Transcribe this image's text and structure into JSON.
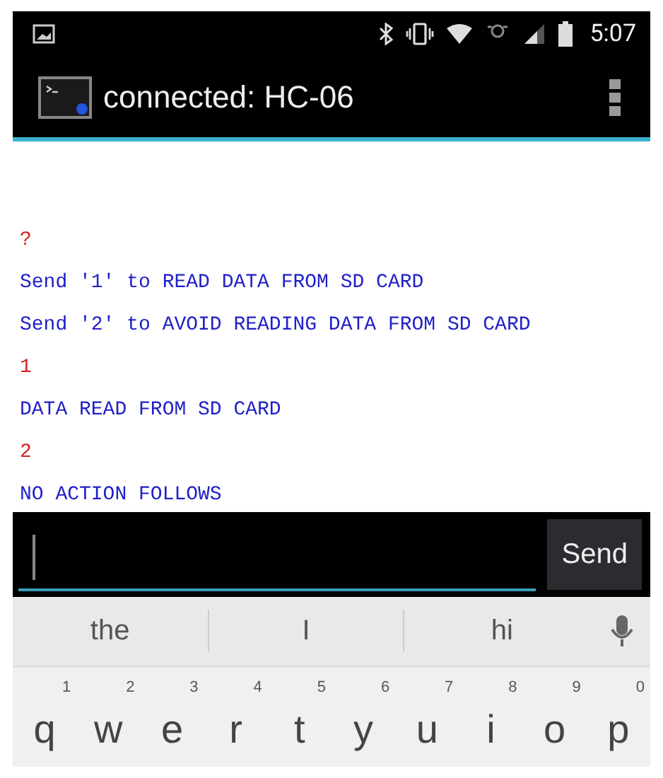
{
  "status_bar": {
    "time": "5:07"
  },
  "action_bar": {
    "title": "connected: HC-06"
  },
  "terminal": {
    "lines": [
      {
        "text": "?",
        "kind": "sent"
      },
      {
        "text": "Send '1' to READ DATA FROM SD CARD",
        "kind": "received"
      },
      {
        "text": "Send '2' to AVOID READING DATA FROM SD CARD",
        "kind": "received"
      },
      {
        "text": "1",
        "kind": "sent"
      },
      {
        "text": "DATA READ FROM SD CARD",
        "kind": "received"
      },
      {
        "text": "2",
        "kind": "sent"
      },
      {
        "text": "NO ACTION FOLLOWS",
        "kind": "received"
      }
    ]
  },
  "input_bar": {
    "button": "Send"
  },
  "keyboard": {
    "suggestions": [
      "the",
      "I",
      "hi"
    ],
    "keys": [
      {
        "letter": "q",
        "digit": "1"
      },
      {
        "letter": "w",
        "digit": "2"
      },
      {
        "letter": "e",
        "digit": "3"
      },
      {
        "letter": "r",
        "digit": "4"
      },
      {
        "letter": "t",
        "digit": "5"
      },
      {
        "letter": "y",
        "digit": "6"
      },
      {
        "letter": "u",
        "digit": "7"
      },
      {
        "letter": "i",
        "digit": "8"
      },
      {
        "letter": "o",
        "digit": "9"
      },
      {
        "letter": "p",
        "digit": "0"
      }
    ]
  }
}
